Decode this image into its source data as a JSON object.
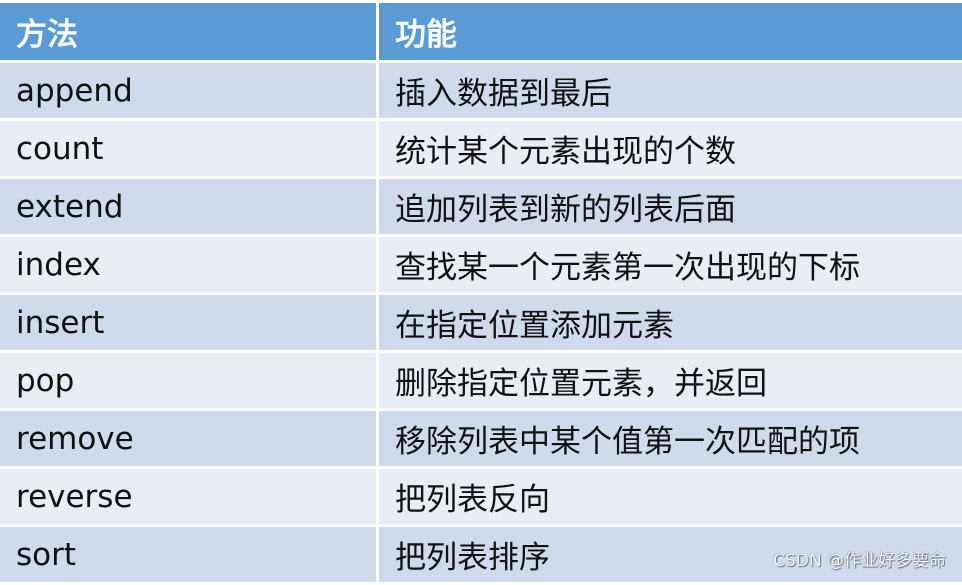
{
  "table": {
    "headers": [
      "方法",
      "功能"
    ],
    "rows": [
      {
        "method": "append",
        "function": "插入数据到最后"
      },
      {
        "method": "count",
        "function": "统计某个元素出现的个数"
      },
      {
        "method": "extend",
        "function": "追加列表到新的列表后面"
      },
      {
        "method": "index",
        "function": "查找某一个元素第一次出现的下标"
      },
      {
        "method": "insert",
        "function": "在指定位置添加元素"
      },
      {
        "method": "pop",
        "function": "删除指定位置元素，并返回"
      },
      {
        "method": "remove",
        "function": "移除列表中某个值第一次匹配的项"
      },
      {
        "method": "reverse",
        "function": "把列表反向"
      },
      {
        "method": "sort",
        "function": "把列表排序"
      }
    ]
  },
  "colors": {
    "header_bg": "#5b9bd5",
    "row_odd_bg": "#cfdbed",
    "row_even_bg": "#e8edf6",
    "text": "#111111"
  },
  "watermark": "CSDN @作业好多要命"
}
